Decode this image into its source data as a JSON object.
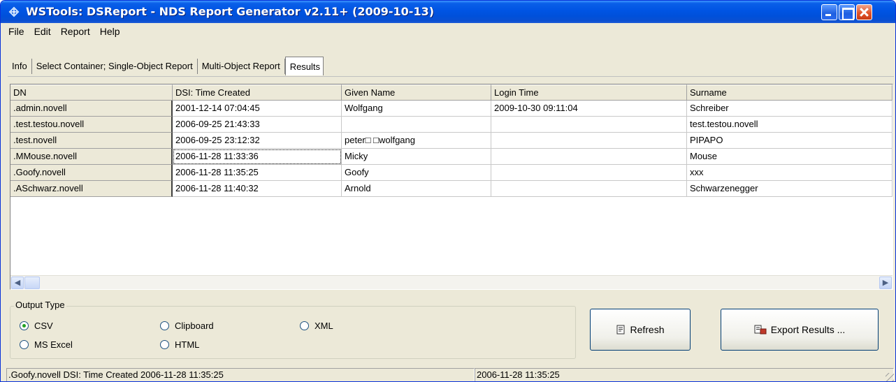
{
  "window": {
    "title": "WSTools: DSReport - NDS Report Generator v2.11+ (2009-10-13)",
    "title_bar_color": "#0054e3",
    "close_color": "#e2542a"
  },
  "menu": [
    "File",
    "Edit",
    "Report",
    "Help"
  ],
  "tabs": [
    {
      "label": "Info",
      "active": false
    },
    {
      "label": "Select Container; Single-Object Report",
      "active": false
    },
    {
      "label": "Multi-Object Report",
      "active": false
    },
    {
      "label": "Results",
      "active": true
    }
  ],
  "grid": {
    "columns": [
      "DN",
      "DSI: Time Created",
      "Given Name",
      "Login Time",
      "Surname"
    ],
    "rows": [
      [
        ".admin.novell",
        "2001-12-14 07:04:45",
        "Wolfgang",
        "2009-10-30 09:11:04",
        "Schreiber"
      ],
      [
        ".test.testou.novell",
        "2006-09-25 21:43:33",
        "",
        "",
        "test.testou.novell"
      ],
      [
        ".test.novell",
        "2006-09-25 23:12:32",
        "peter□ □wolfgang",
        "",
        "PIPAPO"
      ],
      [
        ".MMouse.novell",
        "2006-11-28 11:33:36",
        "Micky",
        "",
        "Mouse"
      ],
      [
        ".Goofy.novell",
        "2006-11-28 11:35:25",
        "Goofy",
        "",
        "xxx"
      ],
      [
        ".ASchwarz.novell",
        "2006-11-28 11:40:32",
        "Arnold",
        "",
        "Schwarzenegger"
      ]
    ],
    "focused_cell": "row 4, DSI: Time Created"
  },
  "output_type": {
    "legend": "Output Type",
    "options": [
      {
        "label": "CSV",
        "checked": true
      },
      {
        "label": "MS Excel",
        "checked": false
      },
      {
        "label": "Clipboard",
        "checked": false
      },
      {
        "label": "HTML",
        "checked": false
      },
      {
        "label": "XML",
        "checked": false
      }
    ]
  },
  "buttons": {
    "refresh": "Refresh",
    "export": "Export Results ..."
  },
  "icons": {
    "app": "app-icon",
    "refresh": "refresh-icon",
    "export": "export-icon"
  },
  "statusbar": {
    "left": ".Goofy.novell  DSI: Time Created    2006-11-28 11:35:25",
    "right": "2006-11-28 11:35:25"
  }
}
